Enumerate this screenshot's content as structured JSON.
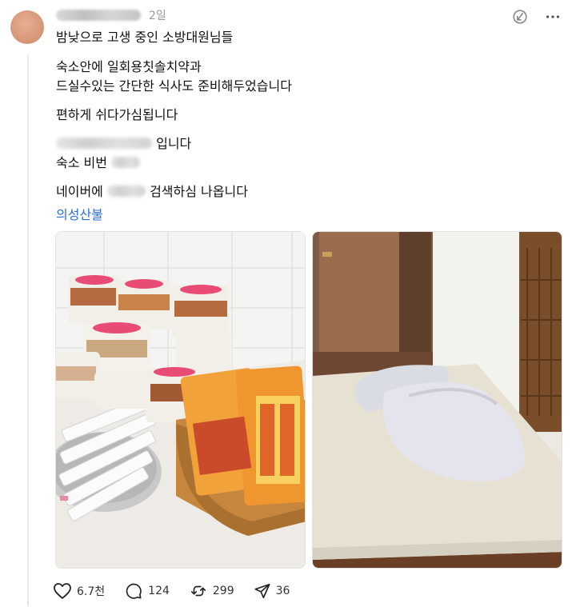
{
  "post": {
    "time": "2일",
    "lines": {
      "l1": "밤낮으로 고생 중인 소방대원님들",
      "l2": "숙소안에 일회용칫솔치약과",
      "l3": "드실수있는 간단한 식사도 준비해두었습니다",
      "l4": "편하게 쉬다가심됩니다",
      "l5_suffix": "입니다",
      "l6_prefix": "숙소 비번",
      "l7_prefix": "네이버에",
      "l7_suffix": "검색하심 나옵니다"
    },
    "tag": "의성산불"
  },
  "actions": {
    "likes": "6.7천",
    "replies": "124",
    "reposts": "299",
    "shares": "36"
  },
  "icons": {
    "more": "more-dots-icon",
    "translate": "translate-icon",
    "like": "heart-icon",
    "reply": "comment-icon",
    "repost": "repost-icon",
    "share": "send-icon"
  }
}
